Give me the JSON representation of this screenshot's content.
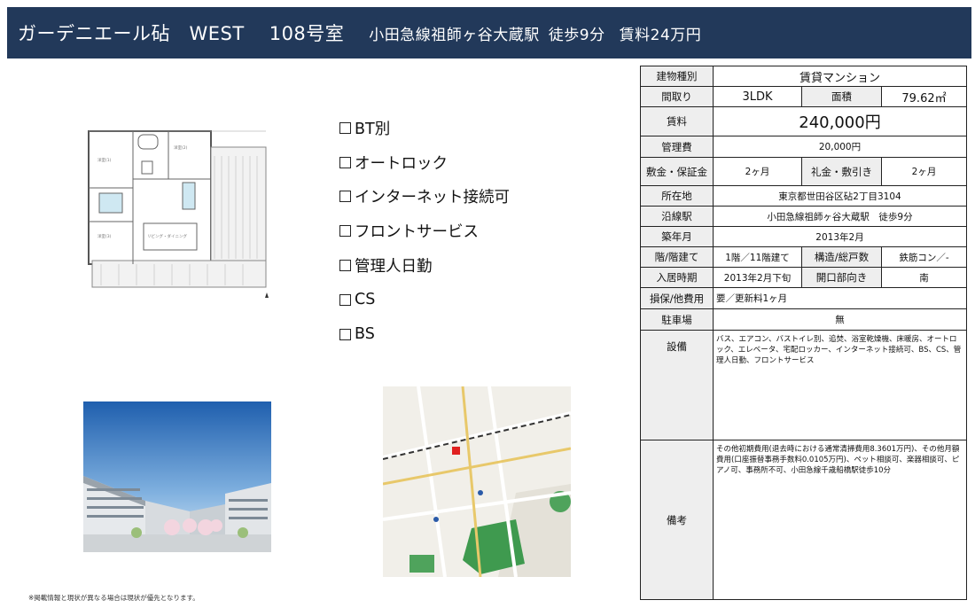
{
  "header": {
    "building_name": "ガーデニエール砧　WEST",
    "room": "108号室",
    "station": "小田急線祖師ヶ谷大蔵駅",
    "walk": "徒歩9分",
    "rent": "賃料24万円"
  },
  "checklist": {
    "items": [
      "BT別",
      "オートロック",
      "インターネット接続可",
      "フロントサービス",
      "管理人日勤",
      "CS",
      "BS"
    ]
  },
  "spec": {
    "building_type_label": "建物種別",
    "building_type": "賃貸マンション",
    "layout_label": "間取り",
    "layout": "3LDK",
    "area_label": "面積",
    "area": "79.62㎡",
    "rent_label": "賃料",
    "rent": "240,000円",
    "mgmt_label": "管理費",
    "mgmt": "20,000円",
    "deposit_label": "敷金・保証金",
    "deposit": "2ヶ月",
    "key_money_label": "礼金・敷引き",
    "key_money": "2ヶ月",
    "address_label": "所在地",
    "address": "東京都世田谷区砧2丁目3104",
    "line_label": "沿線駅",
    "line": "小田急線祖師ヶ谷大蔵駅　徒歩9分",
    "built_label": "築年月",
    "built": "2013年2月",
    "floor_label": "階/階建て",
    "floor": "1階／11階建て",
    "structure_label": "構造/総戸数",
    "structure": "鉄筋コン／-",
    "movein_label": "入居時期",
    "movein": "2013年2月下旬",
    "facing_label": "開口部向き",
    "facing": "南",
    "insurance_label": "損保/他費用",
    "insurance": "要／更新料1ヶ月",
    "parking_label": "駐車場",
    "parking": "無",
    "equipment_label": "設備",
    "equipment": "バス、エアコン、バストイレ別、追焚、浴室乾燥機、床暖房、オートロック、エレベータ、宅配ロッカー、インターネット接続可、BS、CS、管理人日勤、フロントサービス",
    "remarks_label": "備考",
    "remarks": "その他初期費用(退去時における通常清掃費用8.3601万円)、その他月額費用(口座振替事務手数料0.0105万円)、ペット相談可、楽器相談可、ピアノ可、事務所不可、小田急線千歳船橋駅徒歩10分"
  },
  "disclaimer": "※掲載情報と現状が異なる場合は現状が優先となります。"
}
